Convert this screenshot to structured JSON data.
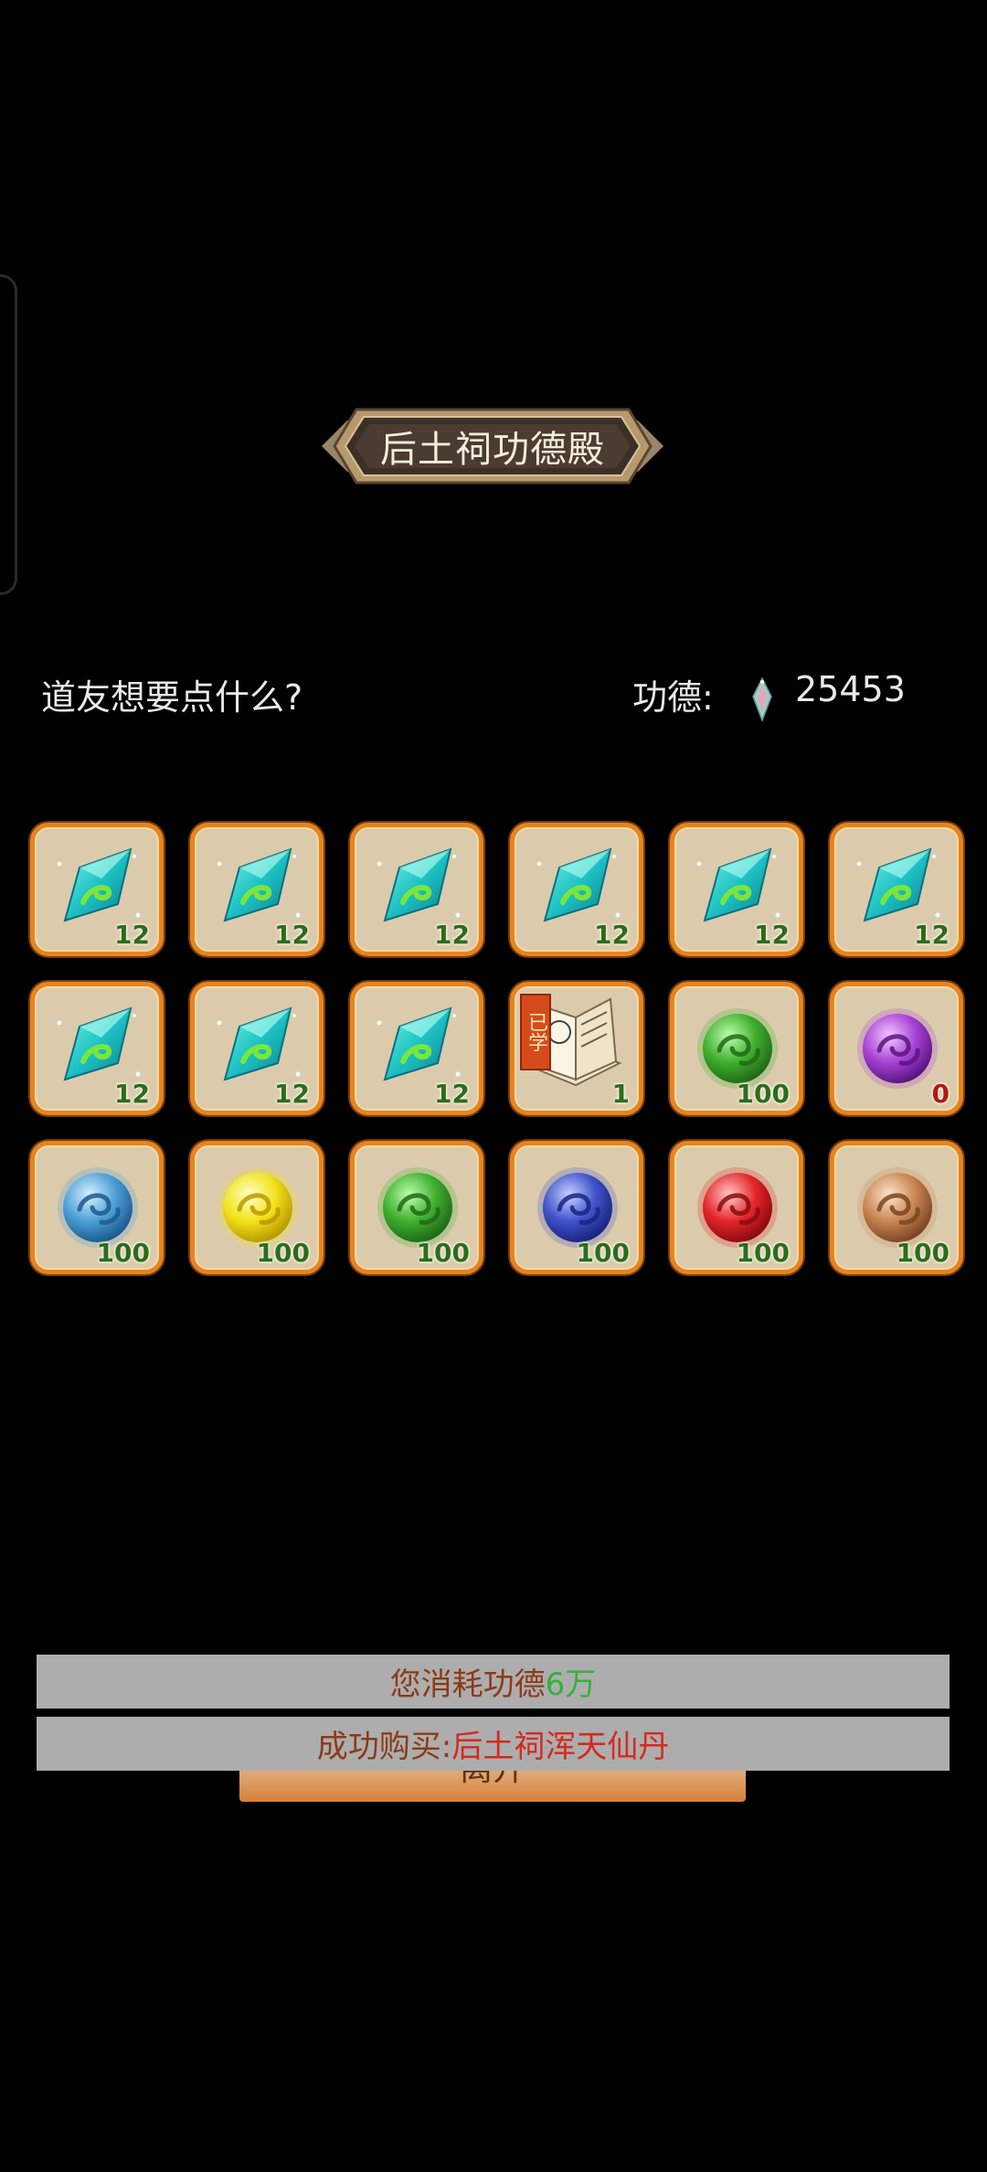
{
  "colors": {
    "slot_border": "#e58422",
    "slot_bg": "#dbcbac",
    "count_green": "#2c6d1a",
    "count_red": "#b21a12"
  },
  "header": {
    "title": "后土祠功德殿"
  },
  "shop": {
    "prompt": "道友想要点什么?",
    "merit_label": "功德:",
    "merit_icon": "merit-crystal-icon",
    "merit_value": "25453"
  },
  "items": [
    {
      "icon": "jade-crystal-icon",
      "count": "12"
    },
    {
      "icon": "jade-crystal-icon",
      "count": "12"
    },
    {
      "icon": "jade-crystal-icon",
      "count": "12"
    },
    {
      "icon": "jade-crystal-icon",
      "count": "12"
    },
    {
      "icon": "jade-crystal-icon",
      "count": "12"
    },
    {
      "icon": "jade-crystal-icon",
      "count": "12"
    },
    {
      "icon": "jade-crystal-icon",
      "count": "12"
    },
    {
      "icon": "jade-crystal-icon",
      "count": "12"
    },
    {
      "icon": "jade-crystal-icon",
      "count": "12"
    },
    {
      "icon": "skill-book-icon",
      "count": "1",
      "tag": "已学"
    },
    {
      "icon": "green-orb-icon",
      "count": "100"
    },
    {
      "icon": "purple-orb-icon",
      "count": "0"
    },
    {
      "icon": "blue-orb-icon",
      "count": "100"
    },
    {
      "icon": "yellow-orb-icon",
      "count": "100"
    },
    {
      "icon": "green-orb-icon",
      "count": "100"
    },
    {
      "icon": "indigo-orb-icon",
      "count": "100"
    },
    {
      "icon": "red-orb-icon",
      "count": "100"
    },
    {
      "icon": "bronze-orb-icon",
      "count": "100"
    }
  ],
  "toasts": {
    "consume_prefix": "您消耗功德",
    "consume_amount": "6万",
    "buy_prefix": "成功购买:",
    "buy_item": "后土祠浑天仙丹"
  },
  "leave_button": {
    "label": "离开"
  }
}
